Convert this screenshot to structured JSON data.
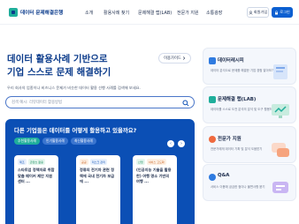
{
  "header": {
    "logo_text": "데이터 문제해결은행",
    "nav": [
      "소개",
      "활용사례 찾기",
      "문제해결 랩(LAB)",
      "전문가 지원",
      "소통광장"
    ],
    "login_label": "회원가입",
    "signup_label": "로그인"
  },
  "hero": {
    "title_line1": "데이터 활용사례 기반으로",
    "title_line2": "기업 스스로 문제 해결하기",
    "description": "우리 회사의 업종이나 비즈니스 문제가 비슷한 데이터 활용 선행 사례를 검색해 보세요.",
    "shortcut_label": "이용가이드"
  },
  "search": {
    "placeholder": "검색 예시: 리뷰데이터 활용방법"
  },
  "panel": {
    "title": "다른 기업들은 데이터를 어떻게 활용하고 있을까요?",
    "chips": [
      "추천활용사례",
      "인기활용사례",
      "최신활용사례"
    ],
    "cards": [
      {
        "badges": [
          "제조",
          "콘텐츠 활용"
        ],
        "title": "스타트업 정책자료 취합 맞춤 메이커 제안 지원 센터 ..."
      },
      {
        "badges": [
          "공공",
          "리스크 관리"
        ],
        "title": "정류의 전기차 관련 정책에 국내 전기차 보급에 ..."
      },
      {
        "badges": [
          "산업",
          "서비스 고도화"
        ],
        "title": "(인공지능 기술을 활용한) 여행 명소 기반의 여행 ..."
      }
    ]
  },
  "side": [
    {
      "title": "데이터레시피",
      "desc": "데이터 분석으로 문제를 해결한 기업 경험 알아보기",
      "color": "#2f7be0"
    },
    {
      "title": "문제해결 랩(LAB)",
      "desc": "데이터를 스스로 도전 분석의 분석 및 도구 활용하기",
      "color": "#1fae9b"
    },
    {
      "title": "전문가 지원",
      "desc": "전문가에게 데이터 기획 및 분석 도움받기",
      "color": "#ef6a3f"
    },
    {
      "title": "Q&A",
      "desc": "서비스 이용에 궁금한 점이나 불편사항 묻기",
      "color": "#2f7be0"
    }
  ]
}
